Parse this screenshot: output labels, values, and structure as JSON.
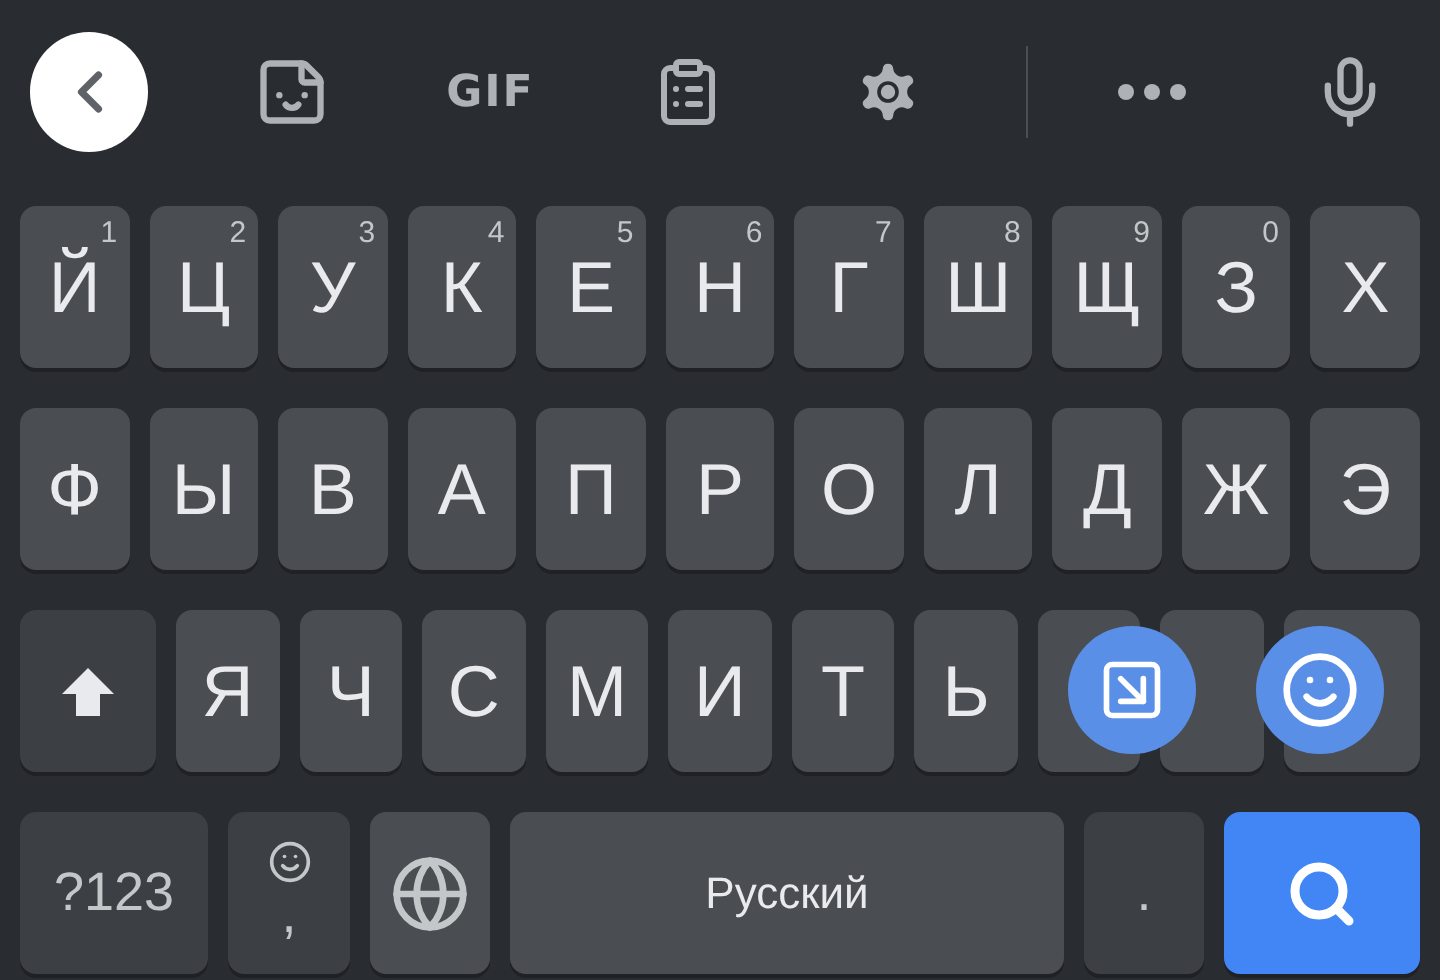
{
  "toolbar": [
    {
      "kind": "back"
    },
    {
      "kind": "sticker"
    },
    {
      "kind": "gif",
      "label": "GIF"
    },
    {
      "kind": "clipboard"
    },
    {
      "kind": "settings"
    },
    {
      "kind": "divider"
    },
    {
      "kind": "more"
    },
    {
      "kind": "mic"
    }
  ],
  "row_1": [
    {
      "label": "Й",
      "hint": "1"
    },
    {
      "label": "Ц",
      "hint": "2"
    },
    {
      "label": "У",
      "hint": "3"
    },
    {
      "label": "К",
      "hint": "4"
    },
    {
      "label": "Е",
      "hint": "5"
    },
    {
      "label": "Н",
      "hint": "6"
    },
    {
      "label": "Г",
      "hint": "7"
    },
    {
      "label": "Ш",
      "hint": "8"
    },
    {
      "label": "Щ",
      "hint": "9"
    },
    {
      "label": "З",
      "hint": "0"
    },
    {
      "label": "Х"
    }
  ],
  "row_2": [
    {
      "label": "Ф"
    },
    {
      "label": "Ы"
    },
    {
      "label": "В"
    },
    {
      "label": "А"
    },
    {
      "label": "П"
    },
    {
      "label": "Р"
    },
    {
      "label": "О"
    },
    {
      "label": "Л"
    },
    {
      "label": "Д"
    },
    {
      "label": "Ж"
    },
    {
      "label": "Э"
    }
  ],
  "row_3": [
    {
      "kind": "shift"
    },
    {
      "kind": "letter",
      "label": "Я"
    },
    {
      "kind": "letter",
      "label": "Ч"
    },
    {
      "kind": "letter",
      "label": "С"
    },
    {
      "kind": "letter",
      "label": "М"
    },
    {
      "kind": "letter",
      "label": "И"
    },
    {
      "kind": "letter",
      "label": "Т"
    },
    {
      "kind": "letter",
      "label": "Ь"
    },
    {
      "kind": "covered"
    },
    {
      "kind": "covered"
    },
    {
      "kind": "covered"
    }
  ],
  "bottom_row": [
    {
      "kind": "symbols",
      "label": "?123"
    },
    {
      "kind": "comma",
      "label": ","
    },
    {
      "kind": "globe"
    },
    {
      "kind": "space",
      "label": "Русский"
    },
    {
      "kind": "period",
      "label": "."
    },
    {
      "kind": "search"
    }
  ],
  "floating_bubbles": [
    {
      "kind": "screenshot"
    },
    {
      "kind": "emoji"
    }
  ]
}
